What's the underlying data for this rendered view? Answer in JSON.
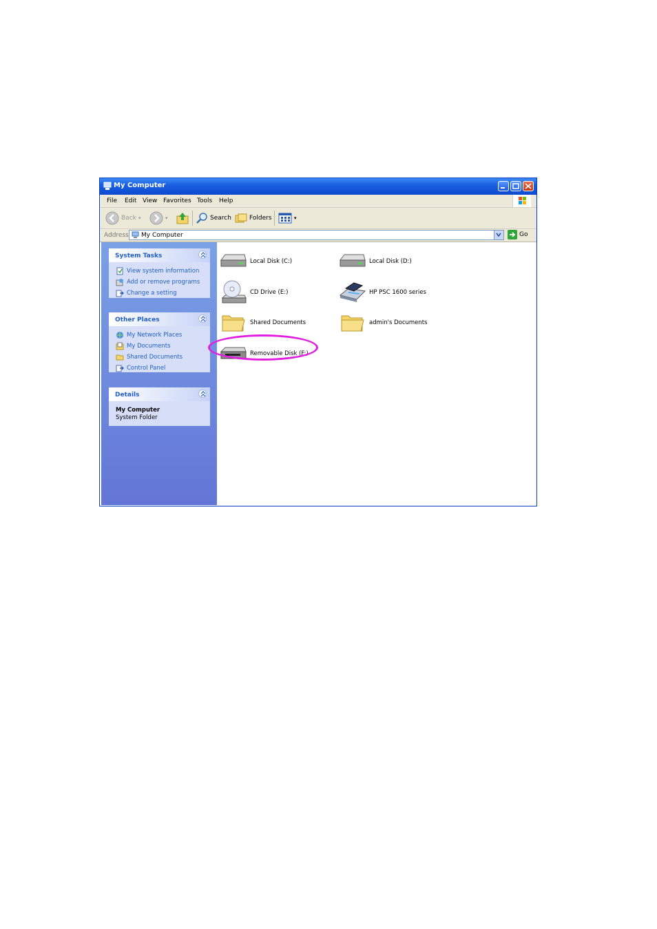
{
  "window": {
    "title": "My Computer",
    "controls": [
      "minimize",
      "maximize",
      "close"
    ]
  },
  "menu": [
    "File",
    "Edit",
    "View",
    "Favorites",
    "Tools",
    "Help"
  ],
  "toolbar": {
    "back_label": "Back",
    "search_label": "Search",
    "folders_label": "Folders"
  },
  "address": {
    "label": "Address",
    "value": "My Computer",
    "go_label": "Go"
  },
  "system_tasks": {
    "title": "System Tasks",
    "items": [
      "View system information",
      "Add or remove programs",
      "Change a setting"
    ]
  },
  "other_places": {
    "title": "Other Places",
    "items": [
      "My Network Places",
      "My Documents",
      "Shared Documents",
      "Control Panel"
    ]
  },
  "details": {
    "title": "Details",
    "name": "My Computer",
    "type": "System Folder"
  },
  "items": [
    {
      "label": "Local Disk (C:)",
      "icon": "hard-drive-icon"
    },
    {
      "label": "Local Disk (D:)",
      "icon": "hard-drive-icon"
    },
    {
      "label": "CD Drive (E:)",
      "icon": "cd-drive-icon"
    },
    {
      "label": "HP PSC 1600 series",
      "icon": "scanner-icon"
    },
    {
      "label": "Shared Documents",
      "icon": "folder-icon"
    },
    {
      "label": "admin's Documents",
      "icon": "folder-icon"
    },
    {
      "label": "Removable Disk (F:)",
      "icon": "removable-disk-icon"
    }
  ],
  "colors": {
    "title_bar": "#0a4ad0",
    "task_pane": "#6375d6",
    "link": "#215dc6",
    "highlight": "#e21ee0"
  }
}
